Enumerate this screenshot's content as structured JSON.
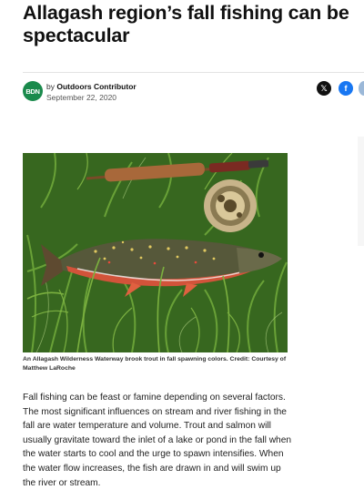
{
  "article": {
    "headline_line1": "Allagash region’s fall fishing can be",
    "headline_line2": "spectacular",
    "publisher_logo": "BDN",
    "by_prefix": "by",
    "author": "Outdoors Contributor",
    "date": "September 22, 2020",
    "caption": "An Allagash Wilderness Waterway brook trout in fall spawning colors. Credit: Courtesy of Matthew LaRoche",
    "body": "Fall fishing can be feast or famine depending on several factors. The most significant influences on stream and river fishing in the fall are water temperature and volume. Trout and salmon will usually gravitate toward the inlet of a lake or pond in the fall when the water starts to cool and the urge to spawn intensifies. When the water flow increases, the fish are drawn in and will swim up the river or stream."
  },
  "share": {
    "x_label": "𝕏",
    "facebook_label": "f"
  },
  "photo": {
    "subject": "brook trout on grass with fly rod and reel",
    "colors": {
      "grass": "#3f7a26",
      "trout_belly": "#d9533a",
      "trout_back": "#5a5a3a",
      "rod": "#a8683a"
    }
  }
}
